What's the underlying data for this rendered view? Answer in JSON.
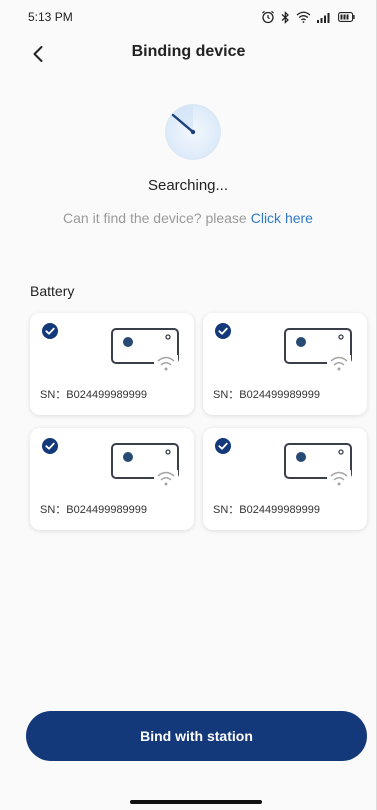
{
  "status_bar": {
    "time": "5:13 PM",
    "icons": [
      "alarm-icon",
      "bluetooth-icon",
      "wifi-icon",
      "signal-icon",
      "battery-icon"
    ]
  },
  "header": {
    "title": "Binding device",
    "back_icon": "chevron-left-icon"
  },
  "search": {
    "status_text": "Searching...",
    "hint_text": "Can it find the device? please",
    "hint_link": "Click here"
  },
  "section": {
    "label": "Battery"
  },
  "devices": [
    {
      "sn": "SN：B024499989999",
      "checked": true
    },
    {
      "sn": "SN：B024499989999",
      "checked": true
    },
    {
      "sn": "SN：B024499989999",
      "checked": true
    },
    {
      "sn": "SN：B024499989999",
      "checked": true
    }
  ],
  "actions": {
    "bind_label": "Bind with station"
  },
  "colors": {
    "primary": "#14397a",
    "link": "#2f79c6",
    "muted_text": "#9a9a9a"
  }
}
